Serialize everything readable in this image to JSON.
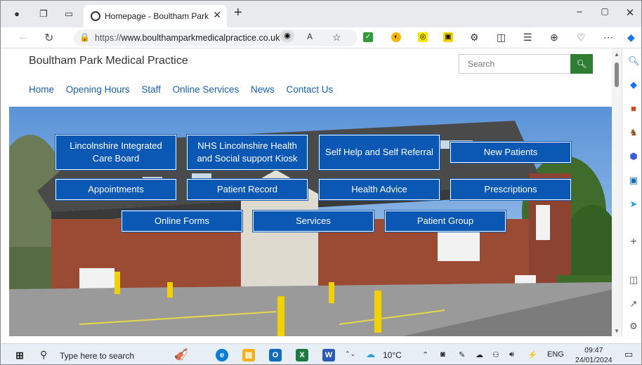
{
  "browser": {
    "tab_title": "Homepage - Boultham Park Medical Practice",
    "url_prefix": "https://",
    "url_host": "www.boulthampark",
    "url_rest": "medicalpractice.co.uk"
  },
  "site": {
    "title": "Boultham Park Medical Practice",
    "search_placeholder": "Search",
    "nav": [
      "Home",
      "Opening Hours",
      "Staff",
      "Online Services",
      "News",
      "Contact Us"
    ]
  },
  "tiles": [
    {
      "label": "Lincolnshire Integrated Care Board"
    },
    {
      "label": "NHS Lincolnshire Health and Social support Kiosk"
    },
    {
      "label": "Self Help and Self Referral"
    },
    {
      "label": "New Patients"
    },
    {
      "label": "Appointments"
    },
    {
      "label": "Patient Record"
    },
    {
      "label": "Health Advice"
    },
    {
      "label": "Prescriptions"
    },
    {
      "label": "Online Forms"
    },
    {
      "label": "Services"
    },
    {
      "label": "Patient Group"
    }
  ],
  "taskbar": {
    "search_text": "Type here to search",
    "weather": "10°C",
    "lang": "ENG",
    "time": "09:47",
    "date": "24/01/2024"
  },
  "colors": {
    "tile_blue": "#0a57b4",
    "nav_link": "#1a5fa8",
    "search_green": "#2e7d32"
  }
}
